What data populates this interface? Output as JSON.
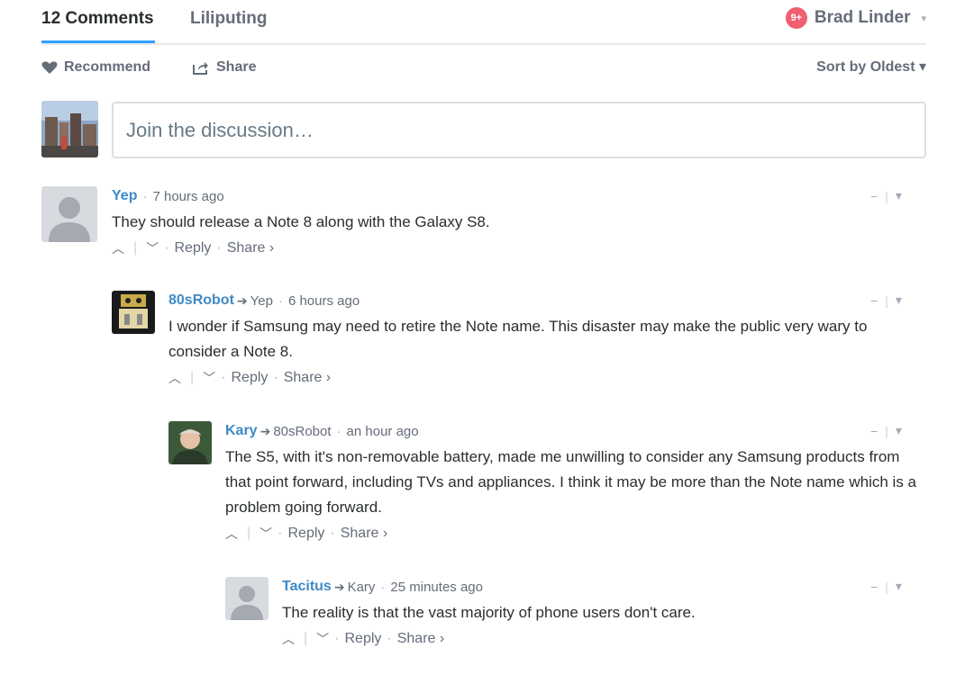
{
  "nav": {
    "comments_tab": "12 Comments",
    "site_tab": "Liliputing",
    "notif_badge": "9+",
    "user_name": "Brad Linder",
    "user_caret": "▾"
  },
  "actions": {
    "recommend": "Recommend",
    "share": "Share",
    "sort": "Sort by Oldest ▾"
  },
  "composer": {
    "placeholder": "Join the discussion…"
  },
  "comments": [
    {
      "author": "Yep",
      "reply_to": "",
      "time": "7 hours ago",
      "text": "They should release a Note 8 along with the Galaxy S8.",
      "avatar": "default-avatar"
    },
    {
      "author": "80sRobot",
      "reply_to": "Yep",
      "time": "6 hours ago",
      "text": "I wonder if Samsung may need to retire the Note name. This disaster may make the public very wary to consider a Note 8.",
      "avatar": "robot-avatar"
    },
    {
      "author": "Kary",
      "reply_to": "80sRobot",
      "time": "an hour ago",
      "text": "The S5, with it's non-removable battery, made me unwilling to consider any Samsung products from that point forward, including TVs and appliances. I think it may be more than the Note name which is a problem going forward.",
      "avatar": "photo-avatar"
    },
    {
      "author": "Tacitus",
      "reply_to": "Kary",
      "time": "25 minutes ago",
      "text": "The reality is that the vast majority of phone users don't care.",
      "avatar": "default-avatar"
    }
  ],
  "labels": {
    "reply": "Reply",
    "share": "Share ›",
    "upvote": "︿",
    "downvote": "﹀",
    "collapse": "−",
    "menu": "▾"
  },
  "colors": {
    "accent": "#2e9fff",
    "author": "#3e8ac6",
    "badge": "#f05f70"
  }
}
